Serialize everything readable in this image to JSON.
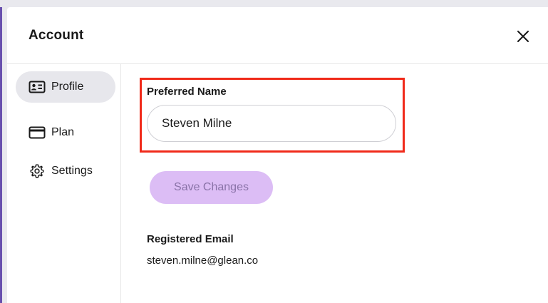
{
  "dialog": {
    "title": "Account",
    "close_icon": "close-icon"
  },
  "sidebar": {
    "items": [
      {
        "label": "Profile",
        "icon": "id-card-icon",
        "active": true
      },
      {
        "label": "Plan",
        "icon": "credit-card-icon",
        "active": false
      },
      {
        "label": "Settings",
        "icon": "gear-icon",
        "active": false
      }
    ]
  },
  "profile": {
    "preferred_name_label": "Preferred Name",
    "preferred_name_value": "Steven Milne",
    "save_button_label": "Save Changes",
    "save_button_enabled": false,
    "registered_email_label": "Registered Email",
    "registered_email_value": "steven.milne@glean.co"
  },
  "colors": {
    "highlight": "#f02a1a",
    "save_button_bg": "#dcbdf5",
    "save_button_text": "#8a73a8",
    "active_nav_bg": "#e7e7ec"
  }
}
